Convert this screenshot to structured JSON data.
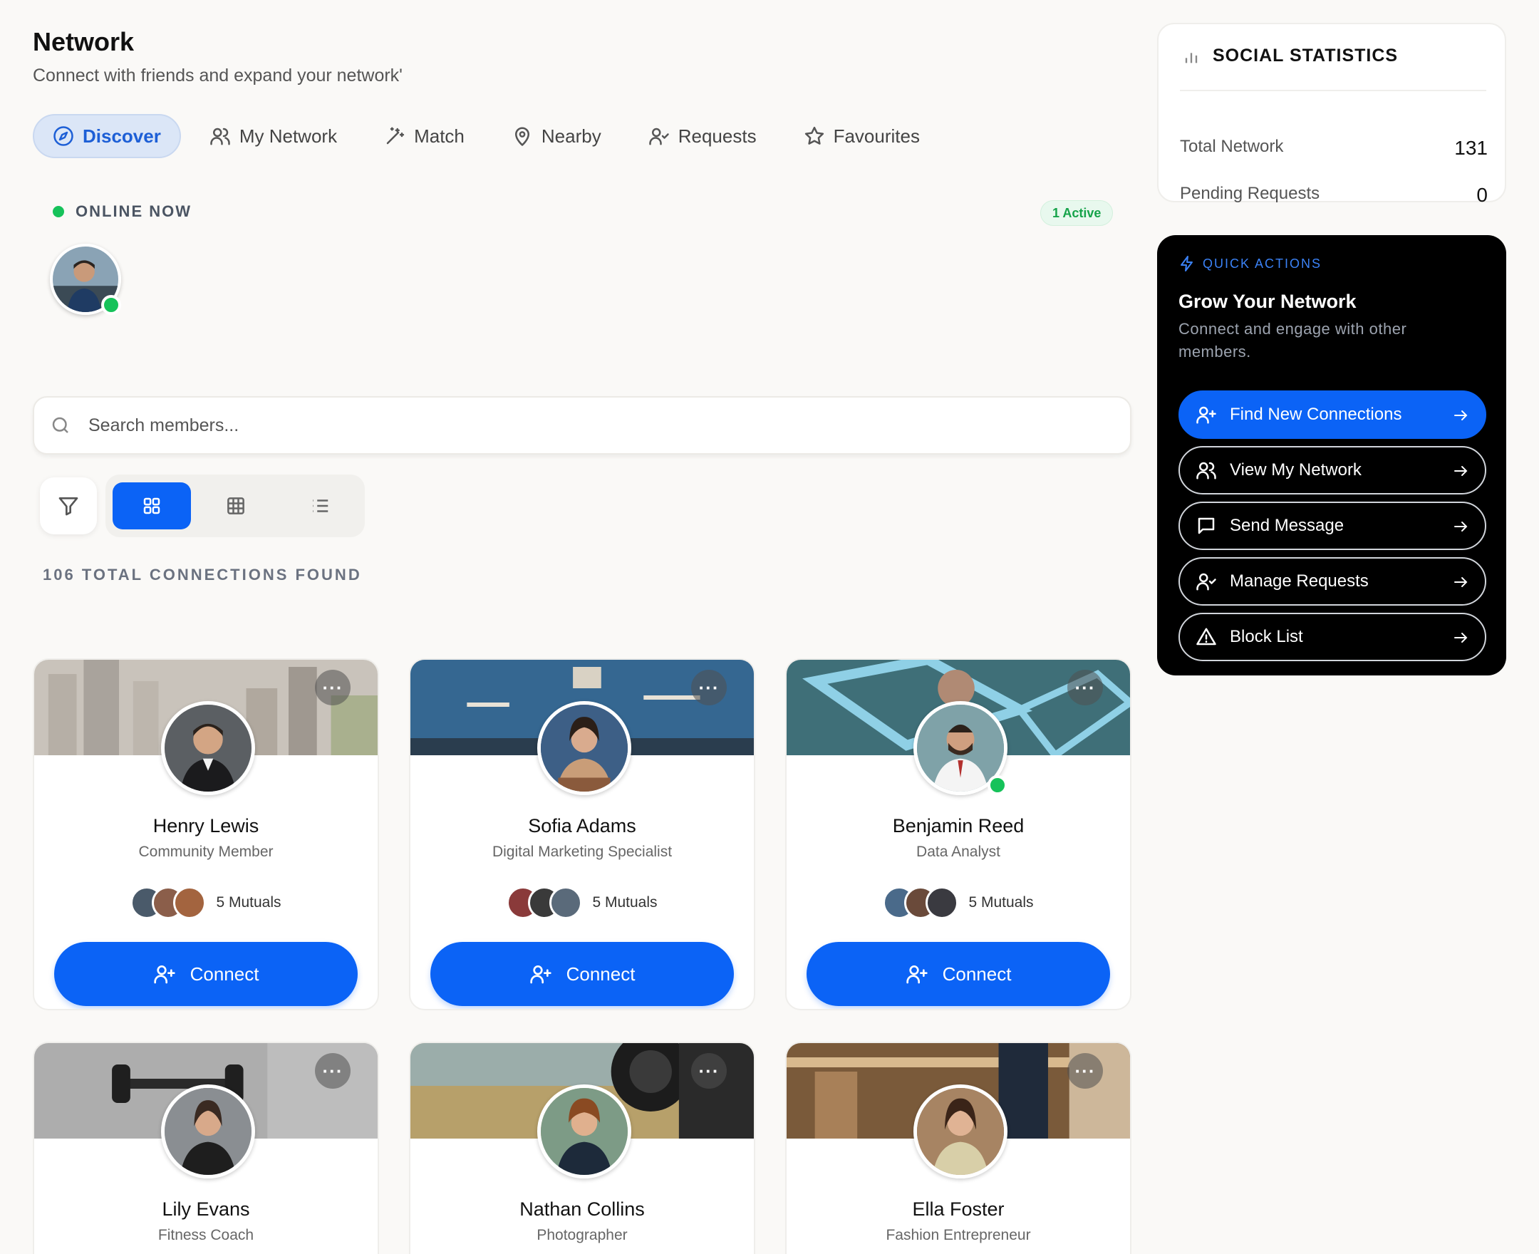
{
  "header": {
    "title": "Network",
    "subtitle": "Connect with friends and expand your network'"
  },
  "tabs": [
    {
      "label": "Discover",
      "icon": "compass-icon",
      "active": true
    },
    {
      "label": "My Network",
      "icon": "users-icon"
    },
    {
      "label": "Match",
      "icon": "wand-icon"
    },
    {
      "label": "Nearby",
      "icon": "map-pin-icon"
    },
    {
      "label": "Requests",
      "icon": "user-check-icon"
    },
    {
      "label": "Favourites",
      "icon": "star-icon"
    }
  ],
  "online": {
    "heading": "ONLINE NOW",
    "active_label": "1 Active"
  },
  "search": {
    "placeholder": "Search members..."
  },
  "results": {
    "count_label": "106 TOTAL CONNECTIONS FOUND"
  },
  "members": [
    {
      "name": "Henry Lewis",
      "role": "Community Member",
      "mutuals": "5 Mutuals",
      "connect": "Connect",
      "online": false
    },
    {
      "name": "Sofia Adams",
      "role": "Digital Marketing Specialist",
      "mutuals": "5 Mutuals",
      "connect": "Connect",
      "online": false
    },
    {
      "name": "Benjamin Reed",
      "role": "Data Analyst",
      "mutuals": "5 Mutuals",
      "connect": "Connect",
      "online": true
    },
    {
      "name": "Lily Evans",
      "role": "Fitness Coach"
    },
    {
      "name": "Nathan Collins",
      "role": "Photographer"
    },
    {
      "name": "Ella Foster",
      "role": "Fashion Entrepreneur"
    }
  ],
  "stats": {
    "title": "SOCIAL STATISTICS",
    "rows": [
      {
        "label": "Total Network",
        "value": "131"
      },
      {
        "label": "Pending Requests",
        "value": "0"
      }
    ]
  },
  "quick_actions": {
    "kicker": "QUICK ACTIONS",
    "title": "Grow Your Network",
    "description": "Connect and engage with other members.",
    "buttons": [
      {
        "label": "Find New Connections",
        "icon": "user-plus-icon"
      },
      {
        "label": "View My Network",
        "icon": "users-icon"
      },
      {
        "label": "Send Message",
        "icon": "message-icon"
      },
      {
        "label": "Manage Requests",
        "icon": "user-check-icon"
      },
      {
        "label": "Block List",
        "icon": "warning-icon"
      }
    ]
  },
  "colors": {
    "accent": "#0b63f6",
    "online": "#16c25a",
    "background": "#faf9f7"
  }
}
